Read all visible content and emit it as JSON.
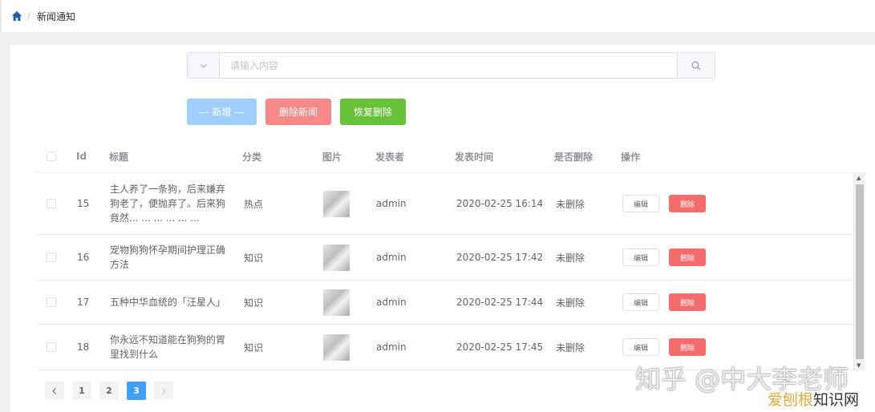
{
  "breadcrumb": {
    "separator": "/",
    "current": "新闻通知"
  },
  "search": {
    "placeholder": "请输入内容",
    "value": ""
  },
  "toolbar": {
    "add_label": "--- 新增 ---",
    "delete_label": "删除新闻",
    "restore_label": "恢复删除"
  },
  "table": {
    "headers": {
      "id": "Id",
      "title": "标题",
      "category": "分类",
      "image": "图片",
      "author": "发表者",
      "time": "发表时间",
      "deleted": "是否删除",
      "actions": "操作"
    },
    "rows": [
      {
        "id": "15",
        "title": "主人养了一条狗，后来嫌弃狗老了，便抛弃了。后来狗竟然... ... ... ... ... ...",
        "category": "热点",
        "author": "admin",
        "time": "2020-02-25 16:14",
        "deleted": "未删除",
        "edit": "编辑",
        "remove": "删除"
      },
      {
        "id": "16",
        "title": "宠物狗狗怀孕期间护理正确方法",
        "category": "知识",
        "author": "admin",
        "time": "2020-02-25 17:42",
        "deleted": "未删除",
        "edit": "编辑",
        "remove": "删除"
      },
      {
        "id": "17",
        "title": "五种中华血统的「汪星人」",
        "category": "知识",
        "author": "admin",
        "time": "2020-02-25 17:44",
        "deleted": "未删除",
        "edit": "编辑",
        "remove": "删除"
      },
      {
        "id": "18",
        "title": "你永远不知道能在狗狗的胃里找到什么",
        "category": "知识",
        "author": "admin",
        "time": "2020-02-25 17:45",
        "deleted": "未删除",
        "edit": "编辑",
        "remove": "删除"
      }
    ]
  },
  "pagination": {
    "pages": [
      "1",
      "2",
      "3"
    ],
    "current": "3"
  },
  "watermark": {
    "line1": "知乎 @中大李老师",
    "line2a": "爱刨根",
    "line2b": "知识网"
  },
  "colors": {
    "primary": "#409eff",
    "danger": "#f56c6c",
    "success": "#67c23a"
  }
}
